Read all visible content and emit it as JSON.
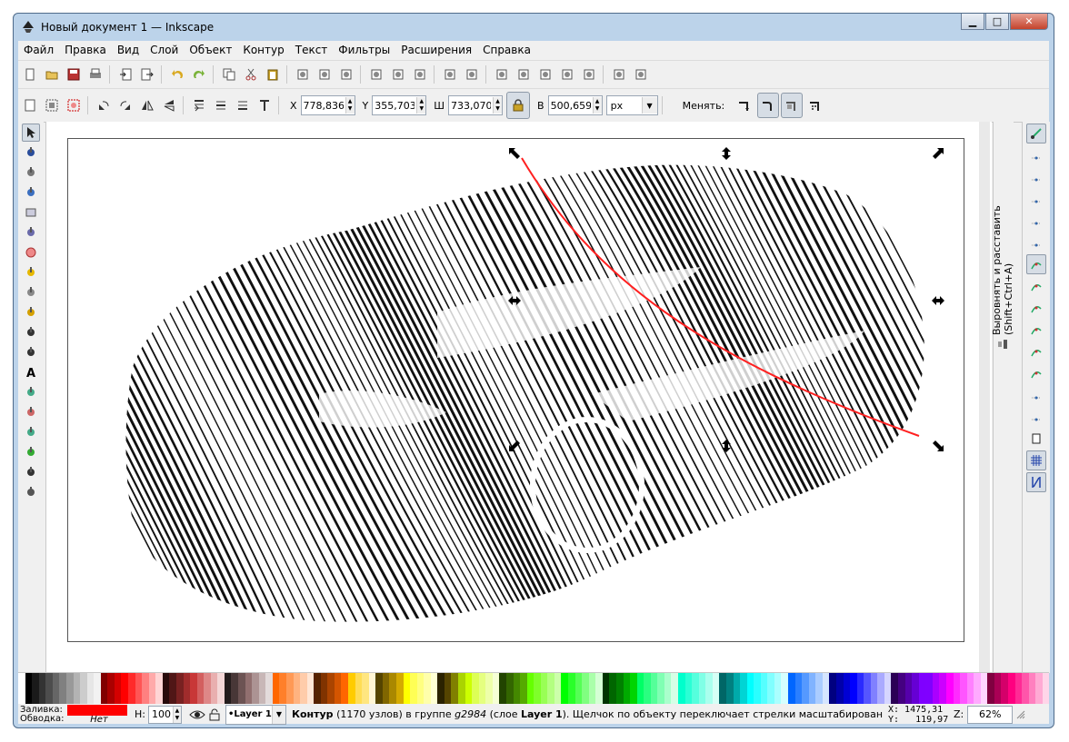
{
  "window": {
    "title": "Новый документ 1 — Inkscape",
    "buttons": {
      "minimize": "▁",
      "maximize": "□",
      "close": "✕"
    }
  },
  "menu": [
    "Файл",
    "Правка",
    "Вид",
    "Слой",
    "Объект",
    "Контур",
    "Текст",
    "Фильтры",
    "Расширения",
    "Справка"
  ],
  "toolbar_main_icons": [
    "new-icon",
    "open-icon",
    "save-icon",
    "print-icon",
    "import-icon",
    "export-icon",
    "undo-icon",
    "redo-icon",
    "copy-icon",
    "cut-icon",
    "paste-icon",
    "zoom-selection-icon",
    "zoom-drawing-icon",
    "zoom-page-icon",
    "duplicate-icon",
    "clone-icon",
    "unlink-clone-icon",
    "group-icon",
    "ungroup-icon",
    "fill-stroke-icon",
    "text-font-icon",
    "layers-icon",
    "xml-editor-icon",
    "align-icon",
    "preferences-icon",
    "document-properties-icon"
  ],
  "selector_toolbar": {
    "x_label": "X",
    "x_value": "778,836",
    "y_label": "Y",
    "y_value": "355,703",
    "w_label": "Ш",
    "w_value": "733,070",
    "h_label": "В",
    "h_value": "500,659",
    "unit": "px",
    "change_label": "Менять:"
  },
  "tools": [
    "selector-icon",
    "node-icon",
    "tweak-icon",
    "zoom-icon",
    "rect-icon",
    "3dbox-icon",
    "circle-icon",
    "star-icon",
    "spiral-icon",
    "pencil-icon",
    "pen-icon",
    "calligraphy-icon",
    "text-icon",
    "spray-icon",
    "eraser-icon",
    "bucket-icon",
    "gradient-icon",
    "dropper-icon",
    "connector-icon"
  ],
  "dock": {
    "label": "Выровнять и расставить (Shift+Ctrl+A)"
  },
  "snap_icons": [
    "snap-enable-icon",
    "snap-bbox-icon",
    "snap-bbox-edge-icon",
    "snap-bbox-corner-icon",
    "snap-bbox-mid-icon",
    "snap-bbox-center-icon",
    "snap-nodes-icon",
    "snap-path-icon",
    "snap-intersection-icon",
    "snap-cusp-icon",
    "snap-smooth-icon",
    "snap-midpoint-icon",
    "snap-center-icon",
    "snap-rotation-icon",
    "snap-page-icon",
    "snap-grid-icon",
    "snap-guide-icon"
  ],
  "palette": [
    "#ffffff",
    "#000000",
    "#1a1a1a",
    "#333333",
    "#4d4d4d",
    "#666666",
    "#808080",
    "#999999",
    "#b3b3b3",
    "#cccccc",
    "#e6e6e6",
    "#f2f2f2",
    "#800000",
    "#aa0000",
    "#d40000",
    "#ff0000",
    "#ff2a2a",
    "#ff5555",
    "#ff8080",
    "#ffaaaa",
    "#ffd5d5",
    "#280b0b",
    "#501616",
    "#782121",
    "#a02c2c",
    "#c83737",
    "#d35f5f",
    "#de8787",
    "#e9afaf",
    "#f4d7d7",
    "#241c1c",
    "#483737",
    "#6c5353",
    "#916f6f",
    "#ac9393",
    "#c8b7b7",
    "#e3dbdb",
    "#ff6600",
    "#ff7f2a",
    "#ff9955",
    "#ffb380",
    "#ffccaa",
    "#ffe6d5",
    "#552200",
    "#803300",
    "#aa4400",
    "#d45500",
    "#ff6600",
    "#ffcc00",
    "#ffdd55",
    "#ffe680",
    "#fff6d5",
    "#554400",
    "#806600",
    "#aa8800",
    "#d4aa00",
    "#ffff00",
    "#ffff55",
    "#ffff80",
    "#ffffaa",
    "#ffffd5",
    "#2b2200",
    "#554400",
    "#808000",
    "#aad400",
    "#ccff00",
    "#ddff55",
    "#e5ff80",
    "#eeffaa",
    "#f6ffd5",
    "#224400",
    "#336600",
    "#448800",
    "#55aa00",
    "#66ff00",
    "#7fff2a",
    "#99ff55",
    "#b3ff80",
    "#ccffaa",
    "#00ff00",
    "#2aff2a",
    "#55ff55",
    "#80ff80",
    "#aaffaa",
    "#d5ffd5",
    "#003300",
    "#006600",
    "#008000",
    "#00aa00",
    "#00d400",
    "#00ff66",
    "#2aff80",
    "#55ff99",
    "#80ffb3",
    "#aaffcc",
    "#d5ffe6",
    "#00ffcc",
    "#2affd5",
    "#55ffdd",
    "#80ffe6",
    "#aaffee",
    "#d5fff6",
    "#006666",
    "#008080",
    "#00aaaa",
    "#00d4d4",
    "#00ffff",
    "#2affff",
    "#55ffff",
    "#80ffff",
    "#aaffff",
    "#d5ffff",
    "#0066ff",
    "#2a7fff",
    "#5599ff",
    "#80b3ff",
    "#aaccff",
    "#d5e5ff",
    "#000080",
    "#0000aa",
    "#0000d4",
    "#0000ff",
    "#2a2aff",
    "#5555ff",
    "#8080ff",
    "#aaaaff",
    "#d5d5ff",
    "#2b0055",
    "#440080",
    "#5500aa",
    "#6600d4",
    "#7f00ff",
    "#8000ff",
    "#aa00ff",
    "#cc00ff",
    "#ff00ff",
    "#ff2aff",
    "#ff55ff",
    "#ff80ff",
    "#ffaaff",
    "#ffd5ff",
    "#800040",
    "#aa0055",
    "#d4006a",
    "#ff0080",
    "#ff2a95",
    "#ff55aa",
    "#ff80bf",
    "#ffaad4",
    "#ffd5e9"
  ],
  "status": {
    "fill_label": "Заливка:",
    "stroke_label": "Обводка:",
    "fill_color": "#ff0000",
    "stroke_value": "Нет",
    "opacity_label": "Н:",
    "opacity_value": "100",
    "layer": "•Layer 1",
    "message_bold": "Контур",
    "message": "(1170 узлов) в группе",
    "message_group": "g2984",
    "message_tail_pre": "(слое",
    "message_layer": "Layer 1",
    "message_tail": "). Щелчок по объекту переключает стрелки масштабирования/вращен",
    "x_coord": "X: 1475,31",
    "y_coord": "Y:   119,97",
    "zoom_label": "Z:",
    "zoom_value": "62%"
  }
}
